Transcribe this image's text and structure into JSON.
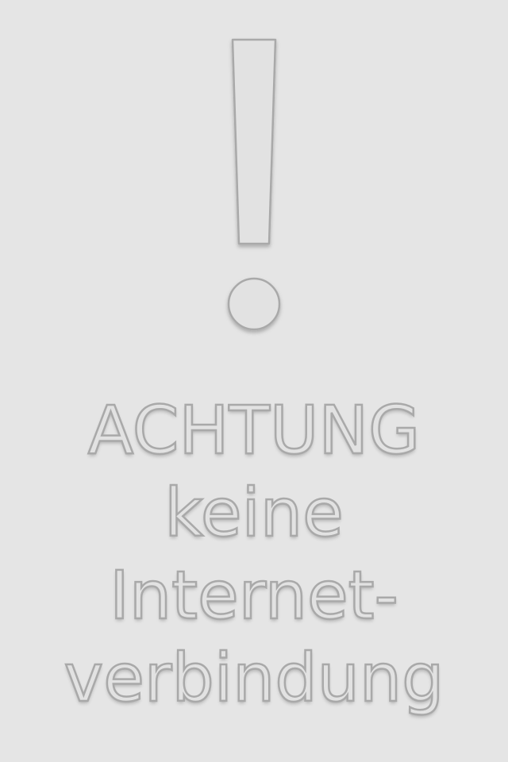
{
  "alert": {
    "icon": "exclamation-mark-icon",
    "lines": {
      "line1": "ACHTUNG",
      "line2": "keine",
      "line3": "Internet-",
      "line4": "verbindung"
    }
  },
  "colors": {
    "background": "#e5e5e5",
    "outline": "#a9a9a9",
    "fill": "#e2e2e2"
  }
}
